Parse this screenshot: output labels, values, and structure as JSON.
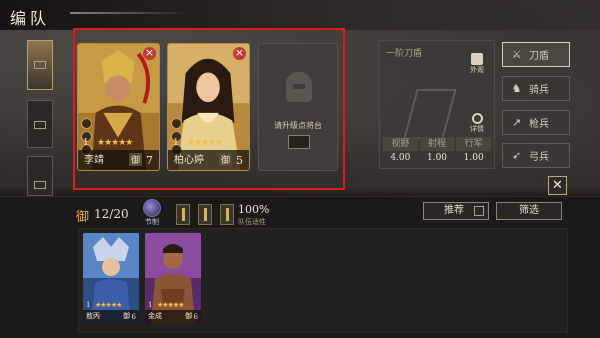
{
  "header": {
    "title": "编队"
  },
  "formation": {
    "cards": [
      {
        "name": "李靖",
        "level": "1",
        "stars": "★★★★★",
        "tag": "御",
        "cost": "7",
        "accent": "#c8952c"
      },
      {
        "name": "柏心婷",
        "level": "1",
        "stars": "★★★★★",
        "tag": "御",
        "cost": "5",
        "accent": "#c8952c"
      }
    ],
    "empty_slot_message": "请升级点将台"
  },
  "troop_info": {
    "name": "一阶刀盾",
    "appearance_label": "外观",
    "detail_label": "详情",
    "stats_headers": [
      "视野",
      "射程",
      "行军"
    ],
    "stats_values": [
      "4.00",
      "1.00",
      "1.00"
    ]
  },
  "troop_types": [
    {
      "label": "刀盾",
      "icon": "sword-shield-icon",
      "active": true
    },
    {
      "label": "骑兵",
      "icon": "horse-icon",
      "active": false
    },
    {
      "label": "枪兵",
      "icon": "spear-icon",
      "active": false
    },
    {
      "label": "弓兵",
      "icon": "bow-icon",
      "active": false
    }
  ],
  "bottom": {
    "faction_label": "御",
    "count": "12/20",
    "jiezhi_label": "节制",
    "fitness_percent": "100%",
    "fitness_label": "队伍适性",
    "recommend_label": "推荐",
    "filter_label": "筛选"
  },
  "roster": [
    {
      "name": "敖丙",
      "level": "1",
      "stars": "★★★★★",
      "tag": "御",
      "cost": "6",
      "accent": "#3b5c9c"
    },
    {
      "name": "金成",
      "level": "1",
      "stars": "★★★★★",
      "tag": "御",
      "cost": "6",
      "accent": "#7a3b8a"
    }
  ],
  "colors": {
    "selection_border": "#e0191f",
    "star": "#f3c04a",
    "gold_frame": "#b78a3c"
  }
}
